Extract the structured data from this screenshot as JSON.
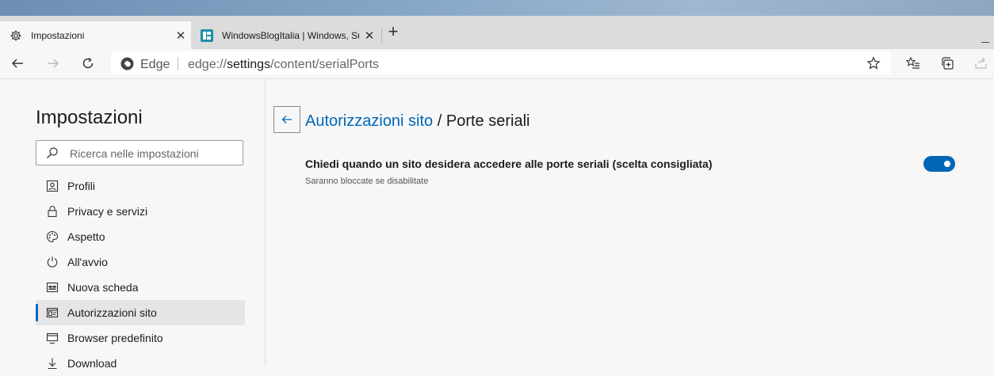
{
  "browser": {
    "tabs": [
      {
        "title": "Impostazioni",
        "icon": "gear-icon",
        "active": true,
        "close": "✕"
      },
      {
        "title": "WindowsBlogItalia | Windows, Su",
        "icon": "site-favicon",
        "active": false,
        "close": "✕"
      }
    ],
    "new_tab": "+",
    "address": {
      "brand": "Edge",
      "url_prefix": "edge://",
      "url_strong": "settings",
      "url_rest": "/content/serialPorts"
    },
    "accent_color": "#0067b8"
  },
  "sidebar": {
    "title": "Impostazioni",
    "search_placeholder": "Ricerca nelle impostazioni",
    "items": [
      {
        "label": "Profili",
        "icon": "profile-icon"
      },
      {
        "label": "Privacy e servizi",
        "icon": "lock-icon"
      },
      {
        "label": "Aspetto",
        "icon": "palette-icon"
      },
      {
        "label": "All'avvio",
        "icon": "power-icon"
      },
      {
        "label": "Nuova scheda",
        "icon": "new-tab-icon"
      },
      {
        "label": "Autorizzazioni sito",
        "icon": "site-permissions-icon",
        "selected": true
      },
      {
        "label": "Browser predefinito",
        "icon": "default-browser-icon"
      },
      {
        "label": "Download",
        "icon": "download-icon"
      }
    ]
  },
  "content": {
    "breadcrumb_link": "Autorizzazioni sito",
    "breadcrumb_sep": " / ",
    "breadcrumb_current": "Porte seriali",
    "setting": {
      "label": "Chiedi quando un sito desidera accedere alle porte seriali (scelta consigliata)",
      "description": "Saranno bloccate se disabilitate",
      "enabled": true
    }
  }
}
